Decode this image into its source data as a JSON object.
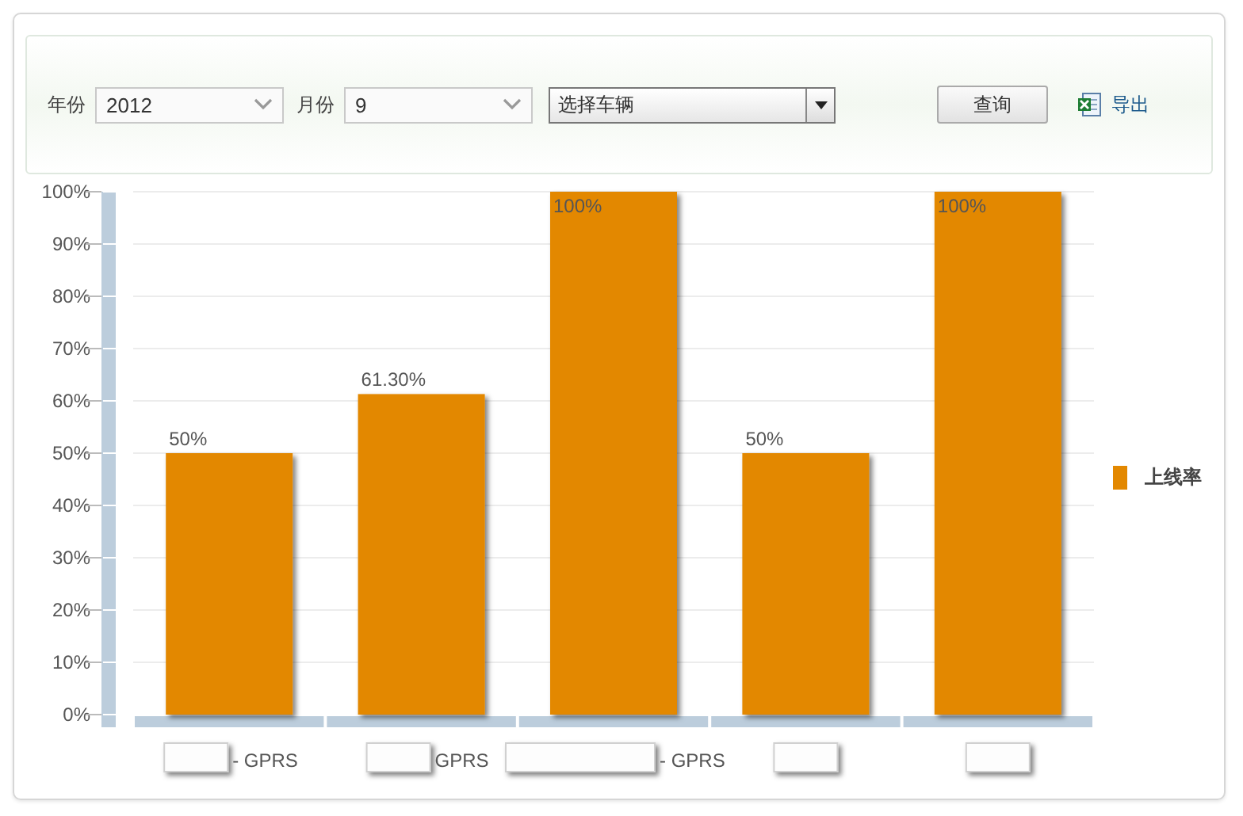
{
  "filters": {
    "year_label": "年份",
    "year": "2012",
    "month_label": "月份",
    "month": "9",
    "vehicle": "选择车辆",
    "query_button": "查询",
    "export_link": "导出"
  },
  "chart": {
    "chart_data": {
      "type": "bar",
      "grid": true,
      "yticks": [
        {
          "value": 0,
          "label": "0%"
        },
        {
          "value": 10,
          "label": "10%"
        },
        {
          "value": 20,
          "label": "20%"
        },
        {
          "value": 30,
          "label": "30%"
        },
        {
          "value": 40,
          "label": "40%"
        },
        {
          "value": 50,
          "label": "50%"
        },
        {
          "value": 60,
          "label": "60%"
        },
        {
          "value": 70,
          "label": "70%"
        },
        {
          "value": 80,
          "label": "80%"
        },
        {
          "value": 90,
          "label": "90%"
        },
        {
          "value": 100,
          "label": "100%"
        }
      ],
      "ylim": [
        0,
        100
      ],
      "series": [
        {
          "name": "上线率",
          "color": "#e38800",
          "values": [
            50,
            61.3,
            100,
            50,
            100
          ]
        }
      ],
      "value_labels": [
        "50%",
        "61.30%",
        "100%",
        "50%",
        "100%"
      ]
    },
    "x_labels": [
      {
        "text": "- GPRS",
        "kind": "masked"
      },
      {
        "text": "GPRS",
        "kind": "masked"
      },
      {
        "text": "- GPRS",
        "kind": "widemasked"
      },
      {
        "kind": "masked"
      },
      {
        "kind": "masked"
      }
    ]
  }
}
